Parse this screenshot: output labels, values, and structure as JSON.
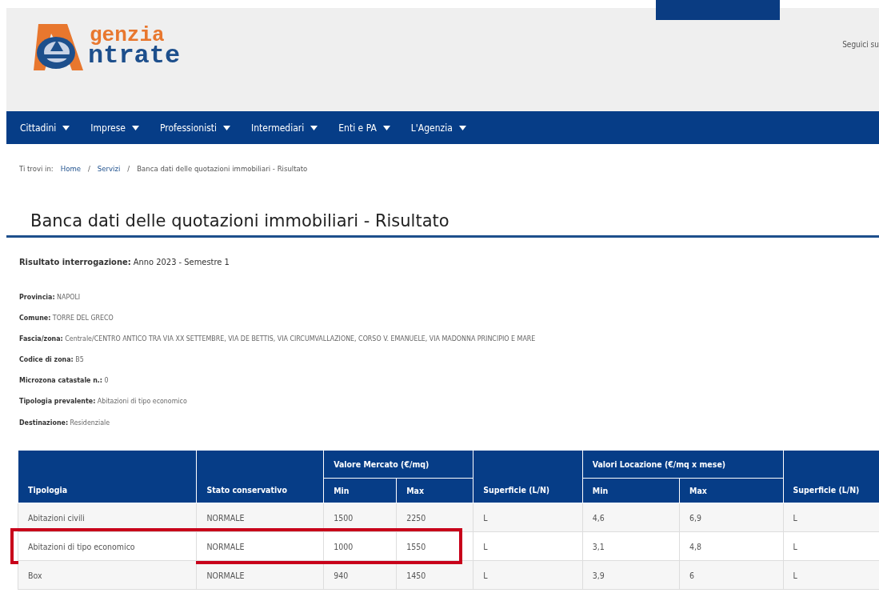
{
  "header": {
    "logo": {
      "line1": "genzia",
      "line2": "ntrate"
    },
    "social_label": "Seguici su"
  },
  "nav": {
    "items": [
      {
        "label": "Cittadini"
      },
      {
        "label": "Imprese"
      },
      {
        "label": "Professionisti"
      },
      {
        "label": "Intermediari"
      },
      {
        "label": "Enti e PA"
      },
      {
        "label": "L'Agenzia"
      }
    ]
  },
  "breadcrumb": {
    "prefix": "Ti trovi in:",
    "links": [
      "Home",
      "Servizi"
    ],
    "separator": "/",
    "current": "Banca dati delle quotazioni immobiliari - Risultato"
  },
  "page_title": "Banca dati delle quotazioni immobiliari - Risultato",
  "result": {
    "label": "Risultato interrogazione:",
    "value": "Anno 2023 - Semestre 1"
  },
  "details": [
    {
      "label": "Provincia:",
      "value": "NAPOLI"
    },
    {
      "label": "Comune:",
      "value": "TORRE DEL GRECO"
    },
    {
      "label": "Fascia/zona:",
      "value": "Centrale/CENTRO ANTICO TRA VIA XX SETTEMBRE, VIA DE BETTIS, VIA CIRCUMVALLAZIONE, CORSO V. EMANUELE, VIA MADONNA PRINCIPIO E MARE"
    },
    {
      "label": "Codice di zona:",
      "value": "B5"
    },
    {
      "label": "Microzona catastale n.:",
      "value": "0"
    },
    {
      "label": "Tipologia prevalente:",
      "value": "Abitazioni di tipo economico"
    },
    {
      "label": "Destinazione:",
      "value": "Residenziale"
    }
  ],
  "table": {
    "group_headers": [
      "Valore Mercato (€/mq)",
      "Valori Locazione (€/mq x mese)"
    ],
    "columns": [
      "Tipologia",
      "Stato conservativo",
      "Min",
      "Max",
      "Superficie (L/N)",
      "Min",
      "Max",
      "Superficie (L/N)"
    ],
    "rows": [
      {
        "cells": [
          "Abitazioni civili",
          "NORMALE",
          "1500",
          "2250",
          "L",
          "4,6",
          "6,9",
          "L"
        ],
        "highlighted": false
      },
      {
        "cells": [
          "Abitazioni di tipo economico",
          "NORMALE",
          "1000",
          "1550",
          "L",
          "3,1",
          "4,8",
          "L"
        ],
        "highlighted": true
      },
      {
        "cells": [
          "Box",
          "NORMALE",
          "940",
          "1450",
          "L",
          "3,9",
          "6",
          "L"
        ],
        "highlighted": false
      }
    ]
  }
}
